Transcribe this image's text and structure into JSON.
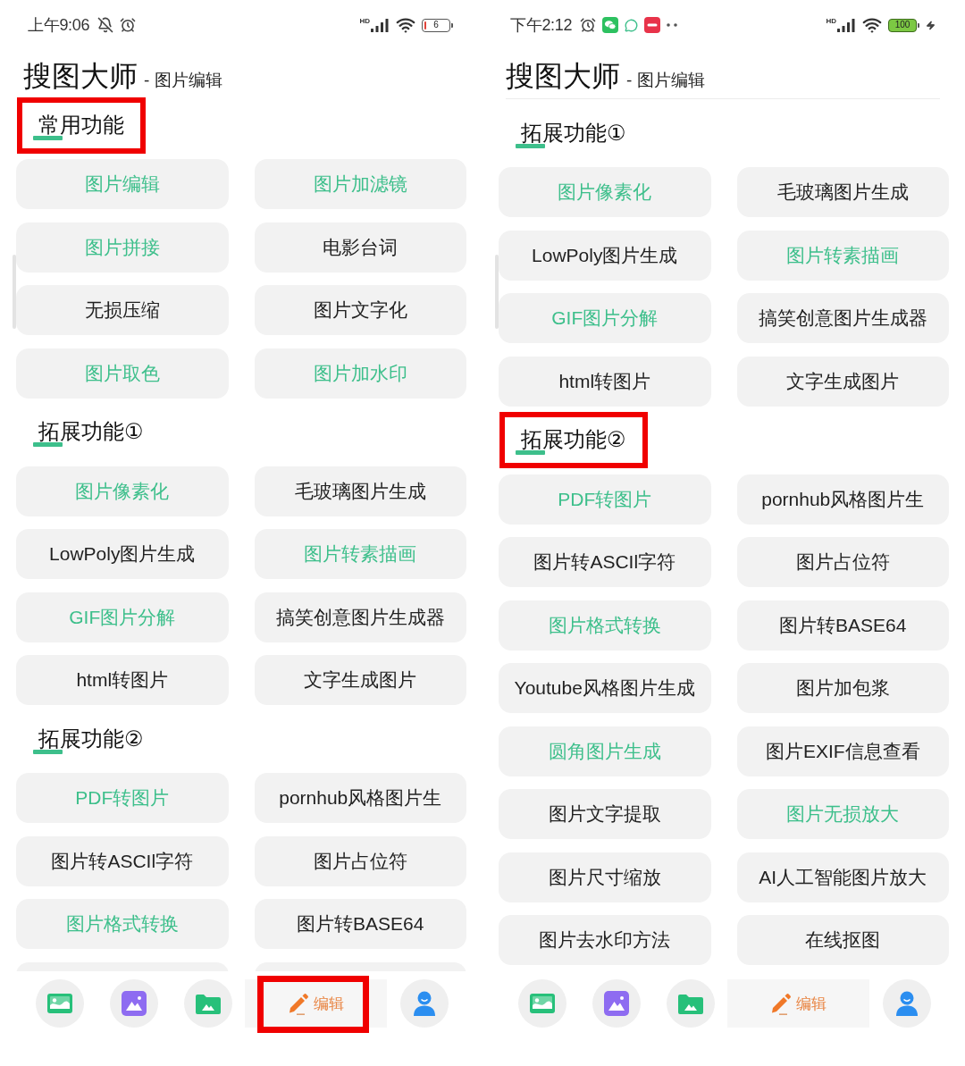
{
  "screens": [
    {
      "status_bar": {
        "time": "上午9:06",
        "icons": [
          {
            "kind": "mute"
          },
          {
            "kind": "alarm"
          }
        ],
        "network_label": "HD",
        "battery": "6",
        "charging": false,
        "low": true
      },
      "title": "搜图大师",
      "subtitle": "- 图片编辑",
      "sections": [
        {
          "title": "常用功能",
          "highlighted": true,
          "items": [
            {
              "label": "图片编辑",
              "accent": true
            },
            {
              "label": "图片加滤镜",
              "accent": true
            },
            {
              "label": "图片拼接",
              "accent": true
            },
            {
              "label": "电影台词",
              "accent": false
            },
            {
              "label": "无损压缩",
              "accent": false
            },
            {
              "label": "图片文字化",
              "accent": false
            },
            {
              "label": "图片取色",
              "accent": true
            },
            {
              "label": "图片加水印",
              "accent": true
            }
          ]
        },
        {
          "title": "拓展功能①",
          "highlighted": false,
          "items": [
            {
              "label": "图片像素化",
              "accent": true
            },
            {
              "label": "毛玻璃图片生成",
              "accent": false
            },
            {
              "label": "LowPoly图片生成",
              "accent": false
            },
            {
              "label": "图片转素描画",
              "accent": true
            },
            {
              "label": "GIF图片分解",
              "accent": true
            },
            {
              "label": "搞笑创意图片生成器",
              "accent": false
            },
            {
              "label": "html转图片",
              "accent": false
            },
            {
              "label": "文字生成图片",
              "accent": false
            }
          ]
        },
        {
          "title": "拓展功能②",
          "highlighted": false,
          "continues": true,
          "items": [
            {
              "label": "PDF转图片",
              "accent": true
            },
            {
              "label": "pornhub风格图片生",
              "accent": false
            },
            {
              "label": "图片转ASCIl字符",
              "accent": false
            },
            {
              "label": "图片占位符",
              "accent": false
            },
            {
              "label": "图片格式转换",
              "accent": true
            },
            {
              "label": "图片转BASE64",
              "accent": false
            }
          ]
        }
      ],
      "nav": [
        {
          "kind": "picture",
          "selected": false
        },
        {
          "kind": "photo",
          "selected": false
        },
        {
          "kind": "folder",
          "selected": false
        },
        {
          "kind": "edit",
          "label": "编辑",
          "selected": true,
          "highlighted": true
        },
        {
          "kind": "profile",
          "selected": false
        }
      ]
    },
    {
      "status_bar": {
        "time": "下午2:12",
        "icons": [
          {
            "kind": "alarm"
          },
          {
            "kind": "chat-app"
          },
          {
            "kind": "message"
          },
          {
            "kind": "red-app"
          },
          {
            "kind": "more"
          }
        ],
        "network_label": "HD",
        "battery": "100",
        "charging": true
      },
      "title": "搜图大师",
      "subtitle": "- 图片编辑",
      "header_divider": true,
      "sections": [
        {
          "title": "拓展功能①",
          "highlighted": false,
          "items": [
            {
              "label": "图片像素化",
              "accent": true
            },
            {
              "label": "毛玻璃图片生成",
              "accent": false
            },
            {
              "label": "LowPoly图片生成",
              "accent": false
            },
            {
              "label": "图片转素描画",
              "accent": true
            },
            {
              "label": "GIF图片分解",
              "accent": true
            },
            {
              "label": "搞笑创意图片生成器",
              "accent": false
            },
            {
              "label": "html转图片",
              "accent": false
            },
            {
              "label": "文字生成图片",
              "accent": false
            }
          ]
        },
        {
          "title": "拓展功能②",
          "highlighted": true,
          "items": [
            {
              "label": "PDF转图片",
              "accent": true
            },
            {
              "label": "pornhub风格图片生",
              "accent": false
            },
            {
              "label": "图片转ASCIl字符",
              "accent": false
            },
            {
              "label": "图片占位符",
              "accent": false
            },
            {
              "label": "图片格式转换",
              "accent": true
            },
            {
              "label": "图片转BASE64",
              "accent": false
            },
            {
              "label": "Youtube风格图片生成",
              "accent": false
            },
            {
              "label": "图片加包浆",
              "accent": false
            },
            {
              "label": "圆角图片生成",
              "accent": true
            },
            {
              "label": "图片EXIF信息查看",
              "accent": false
            },
            {
              "label": "图片文字提取",
              "accent": false
            },
            {
              "label": "图片无损放大",
              "accent": true
            },
            {
              "label": "图片尺寸缩放",
              "accent": false
            },
            {
              "label": "AI人工智能图片放大",
              "accent": false
            },
            {
              "label": "图片去水印方法",
              "accent": false
            },
            {
              "label": "在线抠图",
              "accent": false
            }
          ]
        }
      ],
      "nav": [
        {
          "kind": "picture",
          "selected": false
        },
        {
          "kind": "photo",
          "selected": false
        },
        {
          "kind": "folder",
          "selected": false
        },
        {
          "kind": "edit",
          "label": "编辑",
          "selected": true
        },
        {
          "kind": "profile",
          "selected": false
        }
      ]
    }
  ]
}
